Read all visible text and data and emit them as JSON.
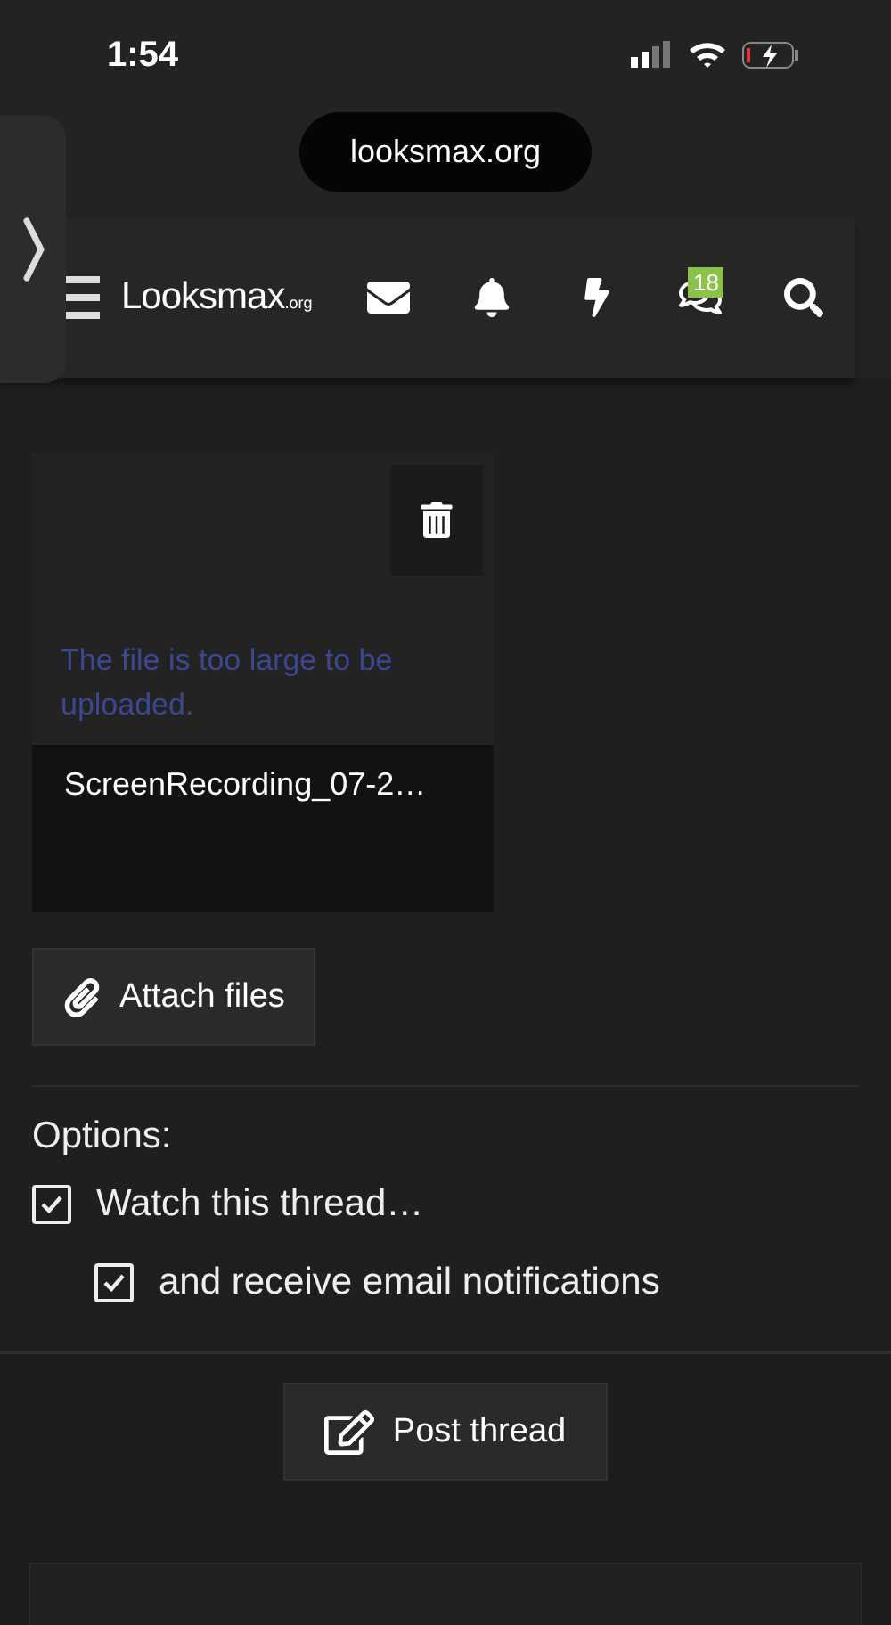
{
  "status_bar": {
    "time": "1:54"
  },
  "browser": {
    "url": "looksmax.org"
  },
  "header": {
    "logo": {
      "name": "Looksmax",
      "suffix": ".org"
    },
    "conversations_badge": "18"
  },
  "attachment": {
    "error": "The file is too large to be uploaded.",
    "filename": "ScreenRecording_07-2…"
  },
  "attach_button": "Attach files",
  "options": {
    "label": "Options:",
    "items": [
      {
        "label": "Watch this thread…",
        "checked": true,
        "children": [
          {
            "label": "and receive email notifications",
            "checked": true
          }
        ]
      }
    ]
  },
  "submit_button": "Post thread"
}
